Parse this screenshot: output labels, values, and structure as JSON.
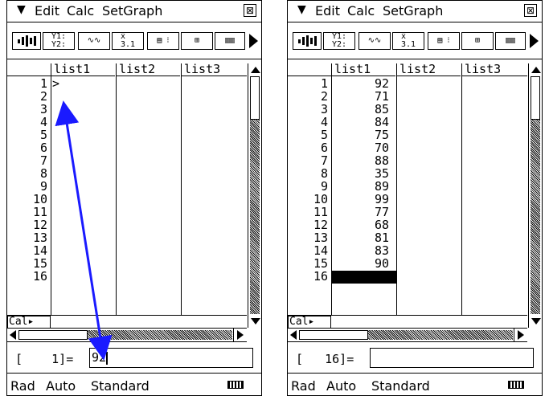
{
  "menu": {
    "edit": "Edit",
    "calc": "Calc",
    "setgraph": "SetGraph",
    "close_glyph": "⊠",
    "menu_glyph": "▼"
  },
  "columns": [
    "list1",
    "list2",
    "list3"
  ],
  "row_numbers": [
    "1",
    "2",
    "3",
    "4",
    "5",
    "6",
    "7",
    "8",
    "9",
    "10",
    "11",
    "12",
    "13",
    "14",
    "15",
    "16"
  ],
  "cal_label": "Cal▸",
  "status": {
    "angle": "Rad",
    "mode": "Auto",
    "format": "Standard"
  },
  "toolbar_icons": [
    "graph-icon",
    "y-equals-icon",
    "stat-calc-icon",
    "stat-summary-icon",
    "regression-icon",
    "window-icon",
    "list-icon"
  ],
  "left": {
    "cursor_marker": ">",
    "entry_label": "[    1]=",
    "entry_value": "92"
  },
  "right": {
    "list1_values": [
      "92",
      "71",
      "85",
      "84",
      "75",
      "70",
      "88",
      "35",
      "89",
      "99",
      "77",
      "68",
      "81",
      "83",
      "90"
    ],
    "entry_label": "[   16]=",
    "entry_value": ""
  },
  "colors": {
    "arrow": "#1a1aff",
    "ink": "#000000",
    "background": "#ffffff"
  }
}
